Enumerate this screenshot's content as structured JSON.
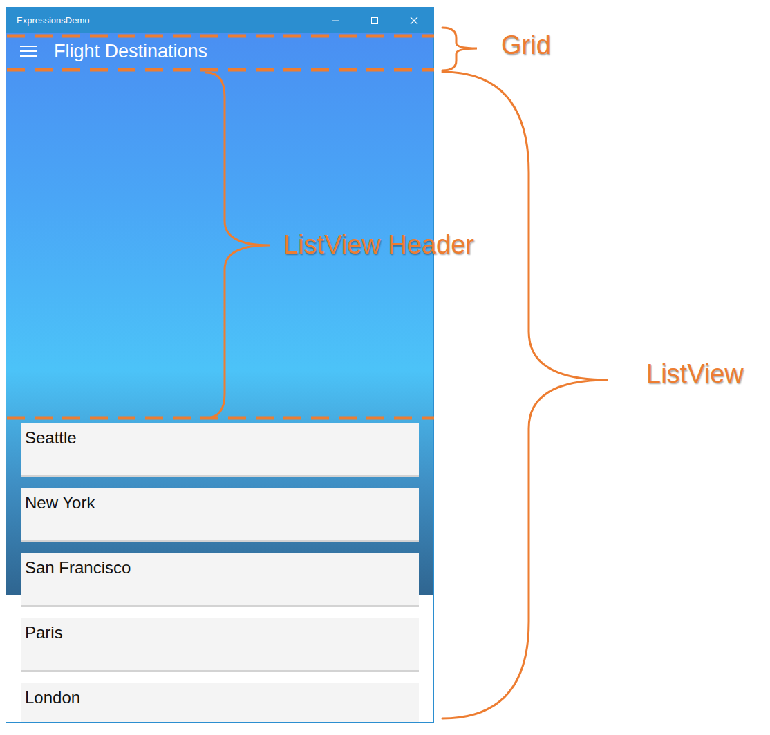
{
  "window": {
    "title": "ExpressionsDemo"
  },
  "app_bar": {
    "title": "Flight Destinations"
  },
  "destinations": [
    {
      "name": "Seattle"
    },
    {
      "name": "New York"
    },
    {
      "name": "San Francisco"
    },
    {
      "name": "Paris"
    },
    {
      "name": "London"
    }
  ],
  "annotations": [
    {
      "label": "Grid"
    },
    {
      "label": "ListView Header"
    },
    {
      "label": "ListView"
    }
  ]
}
